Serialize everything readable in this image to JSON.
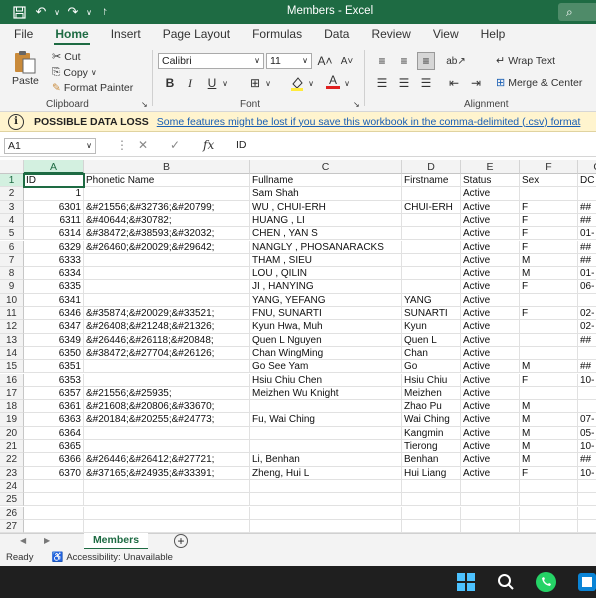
{
  "title": "Members  -  Excel",
  "ribbon_tabs": [
    "File",
    "Home",
    "Insert",
    "Page Layout",
    "Formulas",
    "Data",
    "Review",
    "View",
    "Help"
  ],
  "active_tab": "Home",
  "clipboard": {
    "paste": "Paste",
    "cut": "Cut",
    "copy": "Copy",
    "format_painter": "Format Painter",
    "label": "Clipboard"
  },
  "font": {
    "name": "Calibri",
    "size": "11",
    "label": "Font"
  },
  "alignment": {
    "wrap": "Wrap Text",
    "merge": "Merge & Center",
    "label": "Alignment"
  },
  "warning": {
    "title": "POSSIBLE DATA LOSS",
    "message": "Some features might be lost if you save this workbook in the comma-delimited (.csv) format"
  },
  "formula_bar": {
    "name_box": "A1",
    "content": "ID"
  },
  "columns": [
    {
      "letter": "A",
      "w": 60
    },
    {
      "letter": "B",
      "w": 166
    },
    {
      "letter": "C",
      "w": 152
    },
    {
      "letter": "D",
      "w": 59
    },
    {
      "letter": "E",
      "w": 59
    },
    {
      "letter": "F",
      "w": 58
    },
    {
      "letter": "G",
      "w": 40
    }
  ],
  "column_labels": [
    "A",
    "B",
    "C",
    "D",
    "E",
    "F",
    "G"
  ],
  "g_header": "DC",
  "rows": [
    [
      "ID",
      "Phonetic Name",
      "Fullname",
      "Firstname",
      "Status",
      "Sex",
      "DC"
    ],
    [
      "1",
      "",
      "Sam Shah",
      "",
      "Active",
      "",
      ""
    ],
    [
      "6301",
      "&#21556;&#32736;&#20799;",
      "WU , CHUI-ERH",
      "CHUI-ERH",
      "Active",
      "F",
      "##"
    ],
    [
      "6311",
      "&#40644;&#30782;",
      "HUANG , LI",
      "",
      "Active",
      "F",
      "##"
    ],
    [
      "6314",
      "&#38472;&#38593;&#32032;",
      "CHEN , YAN S",
      "",
      "Active",
      "F",
      "01-"
    ],
    [
      "6329",
      "&#26460;&#20029;&#29642;",
      "NANGLY , PHOSANARACKS",
      "",
      "Active",
      "F",
      "##"
    ],
    [
      "6333",
      "",
      "THAM , SIEU",
      "",
      "Active",
      "M",
      "##"
    ],
    [
      "6334",
      "",
      "LOU , QILIN",
      "",
      "Active",
      "M",
      "01-"
    ],
    [
      "6335",
      "",
      "JI , HANYING",
      "",
      "Active",
      "F",
      "06-"
    ],
    [
      "6341",
      "",
      "YANG, YEFANG",
      "YANG",
      "Active",
      "",
      ""
    ],
    [
      "6346",
      "&#35874;&#20029;&#33521;",
      "FNU, SUNARTI",
      "SUNARTI",
      "Active",
      "F",
      "02-"
    ],
    [
      "6347",
      "&#26408;&#21248;&#21326;",
      "Kyun Hwa, Muh",
      "Kyun",
      "Active",
      "",
      "02-"
    ],
    [
      "6349",
      "&#26446;&#26118;&#20848;",
      "Quen L Nguyen",
      "Quen L",
      "Active",
      "",
      "##"
    ],
    [
      "6350",
      "&#38472;&#27704;&#26126;",
      "Chan WingMing",
      "Chan",
      "Active",
      "",
      ""
    ],
    [
      "6351",
      "",
      "Go See Yam",
      "Go",
      "Active",
      "M",
      "##"
    ],
    [
      "6353",
      "",
      "Hsiu Chiu Chen",
      "Hsiu Chiu",
      "Active",
      "F",
      "10-"
    ],
    [
      "6357",
      "&#21556;&#25935;",
      "Meizhen Wu Knight",
      "Meizhen",
      "Active",
      "",
      ""
    ],
    [
      "6361",
      "&#21608;&#20806;&#33670;",
      "",
      "Zhao Pu",
      "Active",
      "M",
      ""
    ],
    [
      "6363",
      "&#20184;&#20255;&#24773;",
      "Fu, Wai Ching",
      "Wai Ching",
      "Active",
      "M",
      "07-"
    ],
    [
      "6364",
      "",
      "",
      "Kangmin",
      "Active",
      "M",
      "05-"
    ],
    [
      "6365",
      "",
      "",
      "Tierong",
      "Active",
      "M",
      "10-"
    ],
    [
      "6366",
      "&#26446;&#26412;&#27721;",
      "Li, Benhan",
      "Benhan",
      "Active",
      "M",
      "##"
    ],
    [
      "6370",
      "&#37165;&#24935;&#33391;",
      "Zheng, Hui L",
      "Hui Liang",
      "Active",
      "F",
      "10-"
    ],
    [
      "",
      "",
      "",
      "",
      "",
      "",
      ""
    ],
    [
      "",
      "",
      "",
      "",
      "",
      "",
      ""
    ],
    [
      "",
      "",
      "",
      "",
      "",
      "",
      ""
    ],
    [
      "",
      "",
      "",
      "",
      "",
      "",
      ""
    ]
  ],
  "sheet_tab": "Members",
  "status": {
    "ready": "Ready",
    "accessibility": "Accessibility: Unavailable"
  },
  "colors": {
    "accent": "#1e6b43",
    "warning_bg": "#fff4ce",
    "link": "#1a5fb4"
  }
}
